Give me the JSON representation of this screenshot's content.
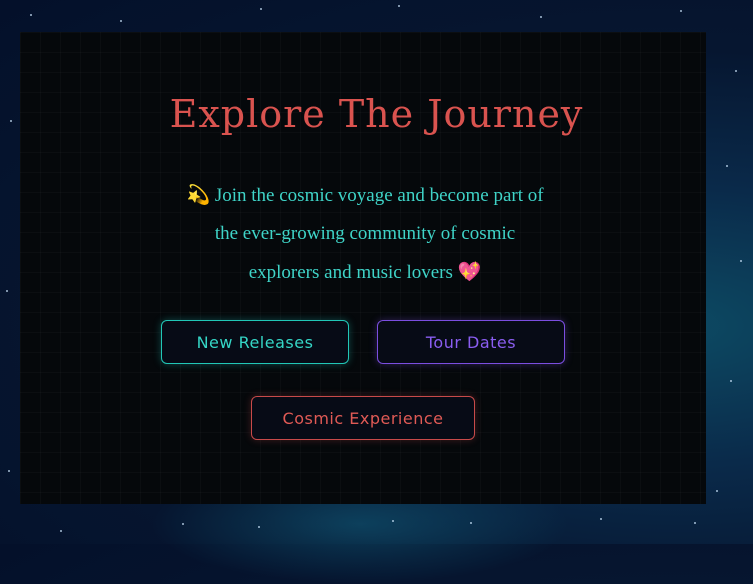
{
  "hero": {
    "title": "Explore The Journey",
    "description": {
      "leading_emoji": "💫",
      "text": "Join the cosmic voyage and become part of the ever-growing community of cosmic explorers and music lovers",
      "trailing_emoji": "💖"
    }
  },
  "actions": {
    "new_releases": "New Releases",
    "tour_dates": "Tour Dates",
    "cosmic_experience": "Cosmic Experience"
  },
  "colors": {
    "title": "#d9534f",
    "description": "#3fd4c8",
    "teal_accent": "#21c7b7",
    "purple_accent": "#7b4ee0",
    "red_accent": "#c84a4a",
    "card_bg": "#05080b"
  }
}
